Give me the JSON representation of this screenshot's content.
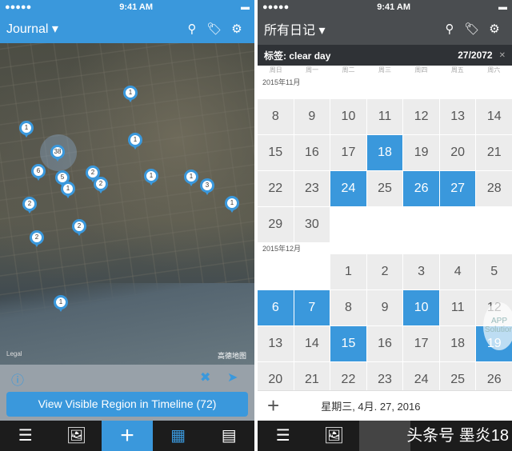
{
  "status": {
    "time": "9:41 AM",
    "signal": "●●●●●",
    "wifi": "wifi-icon",
    "battery": "battery-icon"
  },
  "left": {
    "title": "Journal",
    "pins": [
      "1",
      "1",
      "38",
      "1",
      "6",
      "5",
      "2",
      "1",
      "2",
      "1",
      "1",
      "3",
      "2",
      "1",
      "2",
      "2",
      "1"
    ],
    "legal": "Legal",
    "map_attribution": "高德地图",
    "view_button": "View Visible Region in Timeline (72)",
    "tabs": [
      "list-icon",
      "photos-icon",
      "add-icon",
      "map-icon",
      "calendar-icon"
    ],
    "accent": "#3a98dc"
  },
  "right": {
    "title": "所有日记",
    "filter_label": "标签: clear day",
    "filter_count": "27/2072",
    "weekdays": [
      "周日",
      "周一",
      "周二",
      "周三",
      "周四",
      "周五",
      "周六"
    ],
    "months": [
      {
        "label": "2015年11月",
        "weeks": [
          [
            "8",
            "9",
            "10",
            "11",
            "12",
            "13",
            "14"
          ],
          [
            "15",
            "16",
            "17",
            "18",
            "19",
            "20",
            "21"
          ],
          [
            "22",
            "23",
            "24",
            "25",
            "26",
            "27",
            "28"
          ],
          [
            "29",
            "30",
            "",
            "",
            "",
            "",
            ""
          ]
        ],
        "highlighted": [
          "18",
          "24",
          "26",
          "27"
        ]
      },
      {
        "label": "2015年12月",
        "weeks": [
          [
            "",
            "",
            "1",
            "2",
            "3",
            "4",
            "5"
          ],
          [
            "6",
            "7",
            "8",
            "9",
            "10",
            "11",
            "12"
          ],
          [
            "13",
            "14",
            "15",
            "16",
            "17",
            "18",
            "19"
          ],
          [
            "20",
            "21",
            "22",
            "23",
            "24",
            "25",
            "26"
          ]
        ],
        "highlighted": [
          "6",
          "7",
          "10",
          "15",
          "19"
        ]
      }
    ],
    "date_label": "星期三, 4月. 27, 2016",
    "watermark": "头条号 墨炎18",
    "app_watermark": "APP Solution"
  }
}
